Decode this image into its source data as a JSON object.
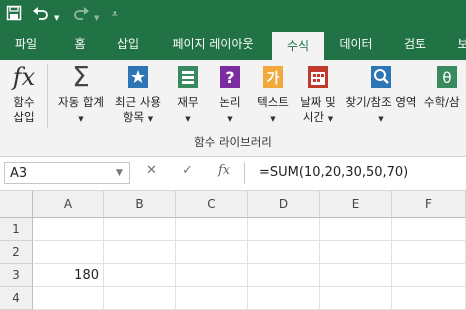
{
  "quick_access": {
    "save_icon": "save-icon",
    "undo_icon": "undo-icon",
    "redo_icon": "redo-icon",
    "customize_icon": "customize-qat-icon"
  },
  "tabs": [
    {
      "label": "파일"
    },
    {
      "label": "홈"
    },
    {
      "label": "삽입"
    },
    {
      "label": "페이지 레이아웃"
    },
    {
      "label": "수식",
      "active": true
    },
    {
      "label": "데이터"
    },
    {
      "label": "검토"
    },
    {
      "label": "보"
    }
  ],
  "ribbon": {
    "insert_function": {
      "line1": "함수",
      "line2": "삽입"
    },
    "autosum": {
      "line1": "자동 합계"
    },
    "recent": {
      "line1": "최근 사용",
      "line2": "항목"
    },
    "financial": {
      "line1": "재무"
    },
    "logical": {
      "line1": "논리"
    },
    "text": {
      "line1": "텍스트"
    },
    "datetime": {
      "line1": "날짜 및",
      "line2": "시간"
    },
    "lookup": {
      "line1": "찾기/참조 영역"
    },
    "math": {
      "line1": "수학/삼"
    },
    "group_label": "함수 라이브러리"
  },
  "formula_bar": {
    "name_box": "A3",
    "formula": "=SUM(10,20,30,50,70)",
    "cancel": "✕",
    "enter": "✓",
    "fx": "fx"
  },
  "sheet": {
    "columns": [
      "A",
      "B",
      "C",
      "D",
      "E",
      "F"
    ],
    "rows": [
      "1",
      "2",
      "3",
      "4"
    ],
    "a3_value": "180"
  },
  "colors": {
    "brand": "#217346",
    "ribbon_bg": "#f3f3f3"
  }
}
